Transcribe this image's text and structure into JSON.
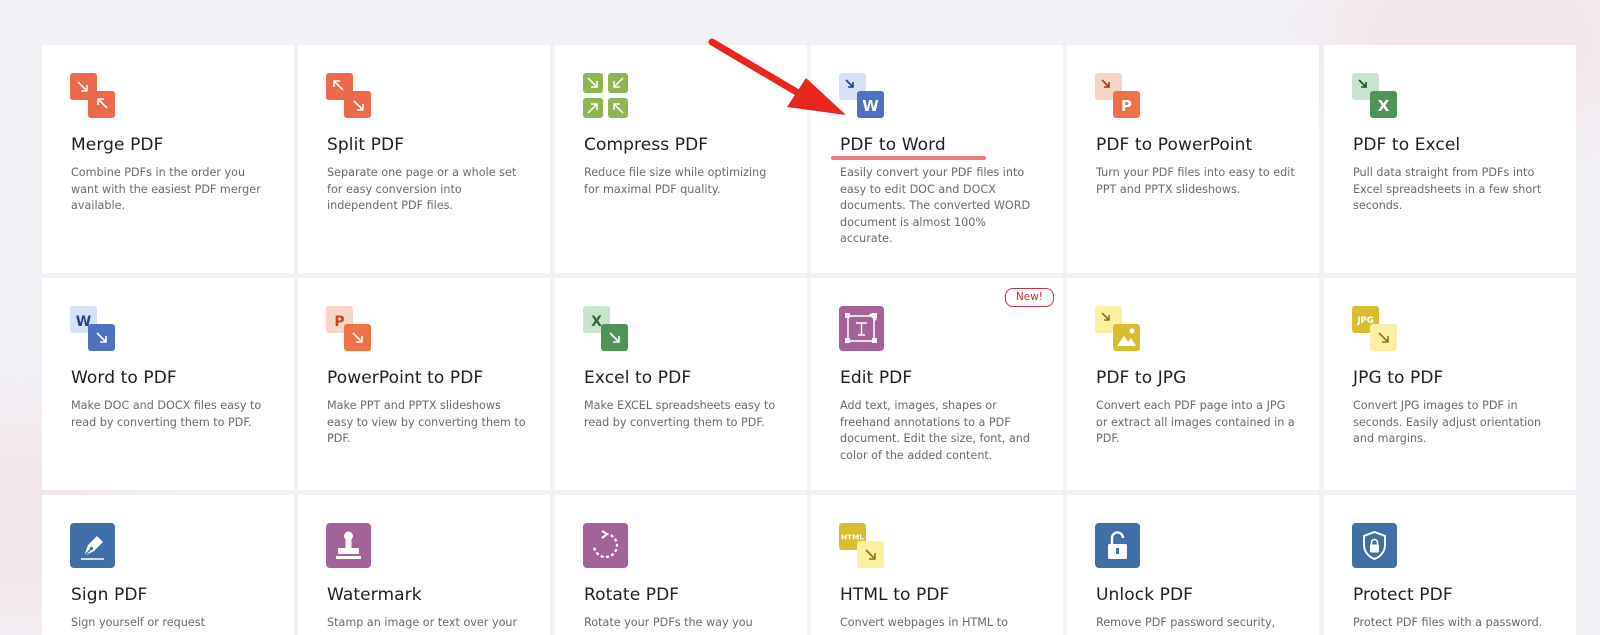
{
  "tools": [
    {
      "id": "merge-pdf",
      "title": "Merge PDF",
      "desc": "Combine PDFs in the order you want with the easiest PDF merger available.",
      "icon": "merge-icon"
    },
    {
      "id": "split-pdf",
      "title": "Split PDF",
      "desc": "Separate one page or a whole set for easy conversion into independent PDF files.",
      "icon": "split-icon"
    },
    {
      "id": "compress-pdf",
      "title": "Compress PDF",
      "desc": "Reduce file size while optimizing for maximal PDF quality.",
      "icon": "compress-icon"
    },
    {
      "id": "pdf-to-word",
      "title": "PDF to Word",
      "desc": "Easily convert your PDF files into easy to edit DOC and DOCX documents. The converted WORD document is almost 100% accurate.",
      "icon": "pdf-to-word-icon",
      "icon_letter": "W"
    },
    {
      "id": "pdf-to-powerpoint",
      "title": "PDF to PowerPoint",
      "desc": "Turn your PDF files into easy to edit PPT and PPTX slideshows.",
      "icon": "pdf-to-powerpoint-icon",
      "icon_letter": "P"
    },
    {
      "id": "pdf-to-excel",
      "title": "PDF to Excel",
      "desc": "Pull data straight from PDFs into Excel spreadsheets in a few short seconds.",
      "icon": "pdf-to-excel-icon",
      "icon_letter": "X"
    },
    {
      "id": "word-to-pdf",
      "title": "Word to PDF",
      "desc": "Make DOC and DOCX files easy to read by converting them to PDF.",
      "icon": "word-to-pdf-icon",
      "icon_letter": "W"
    },
    {
      "id": "powerpoint-to-pdf",
      "title": "PowerPoint to PDF",
      "desc": "Make PPT and PPTX slideshows easy to view by converting them to PDF.",
      "icon": "powerpoint-to-pdf-icon",
      "icon_letter": "P"
    },
    {
      "id": "excel-to-pdf",
      "title": "Excel to PDF",
      "desc": "Make EXCEL spreadsheets easy to read by converting them to PDF.",
      "icon": "excel-to-pdf-icon",
      "icon_letter": "X"
    },
    {
      "id": "edit-pdf",
      "title": "Edit PDF",
      "desc": "Add text, images, shapes or freehand annotations to a PDF document. Edit the size, font, and color of the added content.",
      "icon": "edit-pdf-icon",
      "badge": "New!"
    },
    {
      "id": "pdf-to-jpg",
      "title": "PDF to JPG",
      "desc": "Convert each PDF page into a JPG or extract all images contained in a PDF.",
      "icon": "pdf-to-jpg-icon"
    },
    {
      "id": "jpg-to-pdf",
      "title": "JPG to PDF",
      "desc": "Convert JPG images to PDF in seconds. Easily adjust orientation and margins.",
      "icon": "jpg-to-pdf-icon",
      "icon_letter": "JPG"
    },
    {
      "id": "sign-pdf",
      "title": "Sign PDF",
      "desc": "Sign yourself or request",
      "icon": "sign-pen-icon"
    },
    {
      "id": "watermark",
      "title": "Watermark",
      "desc": "Stamp an image or text over your",
      "icon": "stamp-icon"
    },
    {
      "id": "rotate-pdf",
      "title": "Rotate PDF",
      "desc": "Rotate your PDFs the way you",
      "icon": "rotate-icon"
    },
    {
      "id": "html-to-pdf",
      "title": "HTML to PDF",
      "desc": "Convert webpages in HTML to",
      "icon": "html-to-pdf-icon",
      "icon_letter": "HTML"
    },
    {
      "id": "unlock-pdf",
      "title": "Unlock PDF",
      "desc": "Remove PDF password security,",
      "icon": "unlock-icon"
    },
    {
      "id": "protect-pdf",
      "title": "Protect PDF",
      "desc": "Protect PDF files with a password.",
      "icon": "shield-lock-icon"
    }
  ],
  "colors": {
    "orange": "#ec6a4c",
    "green": "#8db652",
    "word_blue": "#4e72c1",
    "word_light": "#d6e0f6",
    "ppt_orange": "#ef7148",
    "ppt_light": "#f6d4c6",
    "excel_green": "#4f9457",
    "excel_light": "#c9e4cc",
    "purple": "#a5629a",
    "yellow": "#d9bd31",
    "yellow_light": "#fbefa4",
    "steel_blue": "#3e6fa6",
    "annotation_red": "#e8261c",
    "underline_pink": "#f07682",
    "badge_red": "#d0303a"
  }
}
